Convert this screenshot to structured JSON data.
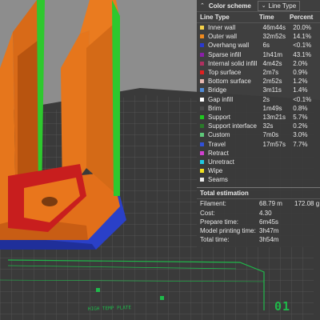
{
  "legend": {
    "title": "Color scheme",
    "view_mode": "Line Type",
    "columns": [
      "Line Type",
      "Time",
      "Percent"
    ],
    "rows": [
      {
        "name": "Inner wall",
        "time": "46m44s",
        "percent": "20.0%",
        "color": "#f5d24a"
      },
      {
        "name": "Outer wall",
        "time": "32m52s",
        "percent": "14.1%",
        "color": "#f08a1e"
      },
      {
        "name": "Overhang wall",
        "time": "6s",
        "percent": "<0.1%",
        "color": "#2a3ad0"
      },
      {
        "name": "Sparse infill",
        "time": "1h41m",
        "percent": "43.1%",
        "color": "#8b1fa8"
      },
      {
        "name": "Internal solid infill",
        "time": "4m42s",
        "percent": "2.0%",
        "color": "#b03060"
      },
      {
        "name": "Top surface",
        "time": "2m7s",
        "percent": "0.9%",
        "color": "#e02020"
      },
      {
        "name": "Bottom surface",
        "time": "2m52s",
        "percent": "1.2%",
        "color": "#e8b8b0"
      },
      {
        "name": "Bridge",
        "time": "3m11s",
        "percent": "1.4%",
        "color": "#4f8ad8"
      },
      {
        "name": "Gap infill",
        "time": "2s",
        "percent": "<0.1%",
        "color": "#ffffff"
      },
      {
        "name": "Brim",
        "time": "1m49s",
        "percent": "0.8%",
        "color": "#4a4a4a"
      },
      {
        "name": "Support",
        "time": "13m21s",
        "percent": "5.7%",
        "color": "#1fc81f"
      },
      {
        "name": "Support interface",
        "time": "32s",
        "percent": "0.2%",
        "color": "#2a7a2a"
      },
      {
        "name": "Custom",
        "time": "7m0s",
        "percent": "3.0%",
        "color": "#5ec87a"
      },
      {
        "name": "Travel",
        "time": "17m57s",
        "percent": "7.7%",
        "color": "#3050d8"
      },
      {
        "name": "Retract",
        "time": "",
        "percent": "",
        "color": "#d040d0"
      },
      {
        "name": "Unretract",
        "time": "",
        "percent": "",
        "color": "#20c8e0"
      },
      {
        "name": "Wipe",
        "time": "",
        "percent": "",
        "color": "#f0e020"
      },
      {
        "name": "Seams",
        "time": "",
        "percent": "",
        "color": "#e8e8e8"
      }
    ],
    "total_title": "Total estimation",
    "estimates": [
      {
        "label": "Filament:",
        "value": "68.79 m",
        "value2": "172.08 g"
      },
      {
        "label": "Cost:",
        "value": "4.30",
        "value2": ""
      },
      {
        "label": "Prepare time:",
        "value": "6m45s",
        "value2": ""
      },
      {
        "label": "Model printing time:",
        "value": "3h47m",
        "value2": ""
      },
      {
        "label": "Total time:",
        "value": "3h54m",
        "value2": ""
      }
    ]
  },
  "bed_id": "01"
}
